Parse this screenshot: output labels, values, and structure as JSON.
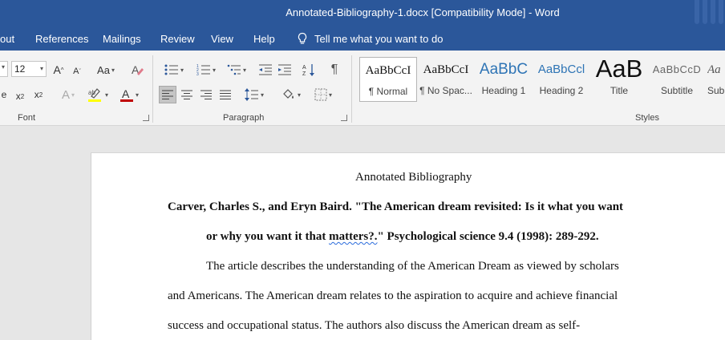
{
  "window": {
    "title": "Annotated-Bibliography-1.docx [Compatibility Mode]  -  Word"
  },
  "tabs": [
    {
      "label": "out"
    },
    {
      "label": "References"
    },
    {
      "label": "Mailings"
    },
    {
      "label": "Review"
    },
    {
      "label": "View"
    },
    {
      "label": "Help"
    }
  ],
  "tell_me": {
    "label": "Tell me what you want to do",
    "icon": "lightbulb-icon"
  },
  "font_group": {
    "label": "Font",
    "font_size": "12",
    "change_case": "Aa",
    "font_color": "#c00000",
    "highlight_color": "#ffff00"
  },
  "paragraph_group": {
    "label": "Paragraph"
  },
  "styles_group": {
    "label": "Styles",
    "items": [
      {
        "preview": "AaBbCcI",
        "name": "¶ Normal"
      },
      {
        "preview": "AaBbCcI",
        "name": "¶ No Spac..."
      },
      {
        "preview": "AaBbC",
        "name": "Heading 1"
      },
      {
        "preview": "AaBbCcl",
        "name": "Heading 2"
      },
      {
        "preview": "AaB",
        "name": "Title"
      },
      {
        "preview": "AaBbCcD",
        "name": "Subtitle"
      },
      {
        "preview": "Aa",
        "name": "Sub"
      }
    ]
  },
  "document": {
    "heading": "Annotated Bibliography",
    "citation_line1": "Carver, Charles S., and Eryn Baird. \"The American dream revisited: Is it what you want",
    "citation_line2_pre": "or why you want it that ",
    "citation_line2_squiggle": "matters?.",
    "citation_line2_post": "\" Psychological science 9.4 (1998): 289-292.",
    "body_line1": "The article describes the understanding of the American Dream as viewed by scholars",
    "body_line2": "and Americans. The American dream relates to the aspiration to acquire and achieve financial",
    "body_line3": "success and occupational status. The authors also discuss the American dream as self-"
  },
  "colors": {
    "title_bar": "#2b579a",
    "ribbon": "#f3f3f3",
    "canvas": "#e6e6e6",
    "heading_style_blue": "#2e74b5"
  }
}
